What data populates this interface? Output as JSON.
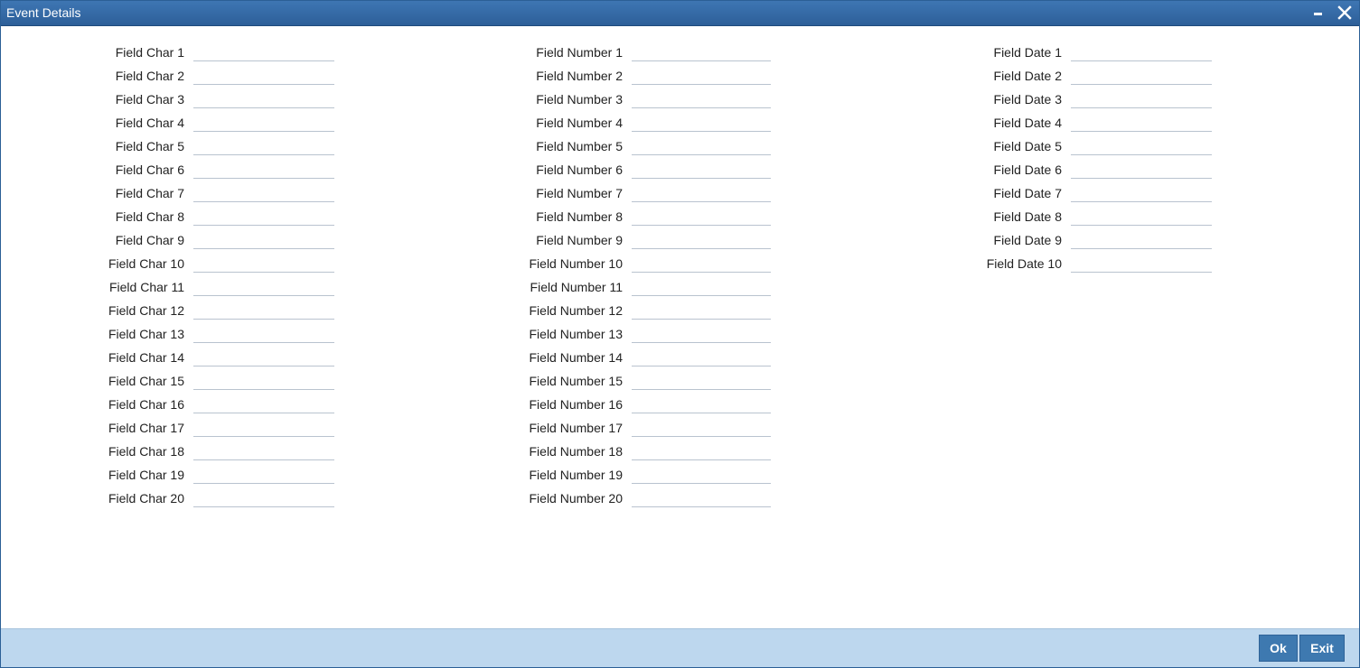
{
  "window": {
    "title": "Event Details",
    "minimize_icon": "minimize-icon",
    "close_icon": "close-icon"
  },
  "char_fields": [
    {
      "label": "Field Char 1",
      "value": ""
    },
    {
      "label": "Field Char 2",
      "value": ""
    },
    {
      "label": "Field Char 3",
      "value": ""
    },
    {
      "label": "Field Char 4",
      "value": ""
    },
    {
      "label": "Field Char 5",
      "value": ""
    },
    {
      "label": "Field Char 6",
      "value": ""
    },
    {
      "label": "Field Char 7",
      "value": ""
    },
    {
      "label": "Field Char 8",
      "value": ""
    },
    {
      "label": "Field Char 9",
      "value": ""
    },
    {
      "label": "Field Char 10",
      "value": ""
    },
    {
      "label": "Field Char 11",
      "value": ""
    },
    {
      "label": "Field Char 12",
      "value": ""
    },
    {
      "label": "Field Char 13",
      "value": ""
    },
    {
      "label": "Field Char 14",
      "value": ""
    },
    {
      "label": "Field Char 15",
      "value": ""
    },
    {
      "label": "Field Char 16",
      "value": ""
    },
    {
      "label": "Field Char 17",
      "value": ""
    },
    {
      "label": "Field Char 18",
      "value": ""
    },
    {
      "label": "Field Char 19",
      "value": ""
    },
    {
      "label": "Field Char 20",
      "value": ""
    }
  ],
  "number_fields": [
    {
      "label": "Field Number 1",
      "value": ""
    },
    {
      "label": "Field Number 2",
      "value": ""
    },
    {
      "label": "Field Number 3",
      "value": ""
    },
    {
      "label": "Field Number 4",
      "value": ""
    },
    {
      "label": "Field Number 5",
      "value": ""
    },
    {
      "label": "Field Number 6",
      "value": ""
    },
    {
      "label": "Field Number 7",
      "value": ""
    },
    {
      "label": "Field Number 8",
      "value": ""
    },
    {
      "label": "Field Number 9",
      "value": ""
    },
    {
      "label": "Field Number 10",
      "value": ""
    },
    {
      "label": "Field Number 11",
      "value": ""
    },
    {
      "label": "Field Number 12",
      "value": ""
    },
    {
      "label": "Field Number 13",
      "value": ""
    },
    {
      "label": "Field Number 14",
      "value": ""
    },
    {
      "label": "Field Number 15",
      "value": ""
    },
    {
      "label": "Field Number 16",
      "value": ""
    },
    {
      "label": "Field Number 17",
      "value": ""
    },
    {
      "label": "Field Number 18",
      "value": ""
    },
    {
      "label": "Field Number 19",
      "value": ""
    },
    {
      "label": "Field Number 20",
      "value": ""
    }
  ],
  "date_fields": [
    {
      "label": "Field Date 1",
      "value": ""
    },
    {
      "label": "Field Date 2",
      "value": ""
    },
    {
      "label": "Field Date 3",
      "value": ""
    },
    {
      "label": "Field Date 4",
      "value": ""
    },
    {
      "label": "Field Date 5",
      "value": ""
    },
    {
      "label": "Field Date 6",
      "value": ""
    },
    {
      "label": "Field Date 7",
      "value": ""
    },
    {
      "label": "Field Date 8",
      "value": ""
    },
    {
      "label": "Field Date 9",
      "value": ""
    },
    {
      "label": "Field Date 10",
      "value": ""
    }
  ],
  "footer": {
    "ok_label": "Ok",
    "exit_label": "Exit"
  },
  "colors": {
    "titlebar": "#2d5f99",
    "footer_bg": "#bdd7ee",
    "button_bg": "#3e79b0"
  }
}
